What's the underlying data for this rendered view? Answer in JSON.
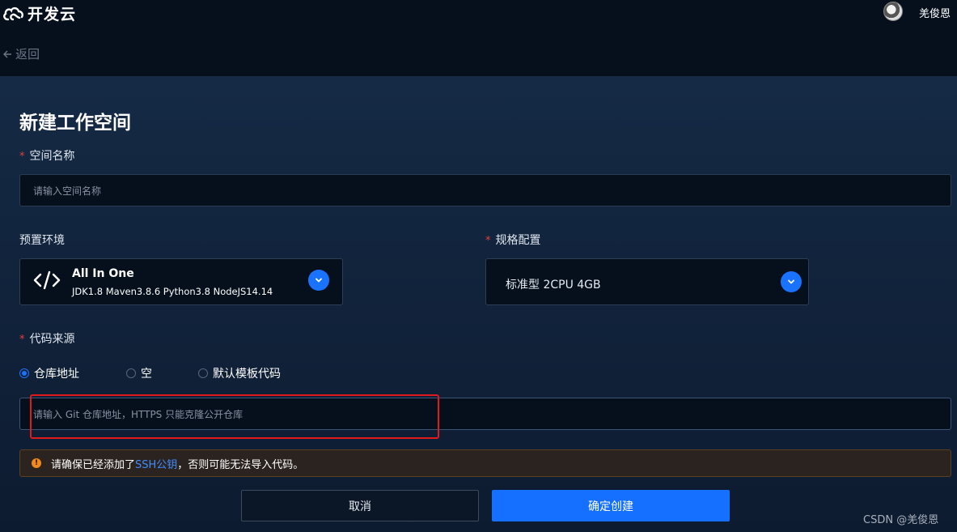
{
  "header": {
    "logo_text": "开发云",
    "username": "羌俊恩"
  },
  "nav": {
    "back_label": "返回"
  },
  "form": {
    "title": "新建工作空间",
    "space_name": {
      "required_mark": "*",
      "label": "空间名称",
      "placeholder": "请输入空间名称"
    },
    "preset_env": {
      "label": "预置环境",
      "selected_title": "All In One",
      "selected_desc": "JDK1.8 Maven3.8.6 Python3.8 NodeJS14.14",
      "icon": "code-icon"
    },
    "spec": {
      "required_mark": "*",
      "label": "规格配置",
      "selected": "标准型 2CPU 4GB"
    },
    "code_source": {
      "required_mark": "*",
      "label": "代码来源",
      "options": [
        {
          "label": "仓库地址",
          "checked": true
        },
        {
          "label": "空",
          "checked": false
        },
        {
          "label": "默认模板代码",
          "checked": false
        }
      ],
      "repo_placeholder": "请输入 Git 仓库地址，HTTPS 只能克隆公开仓库"
    },
    "alert": {
      "prefix": "请确保已经添加了 ",
      "link": "SSH公钥",
      "suffix": "，否则可能无法导入代码。"
    },
    "buttons": {
      "cancel": "取消",
      "confirm": "确定创建"
    }
  },
  "watermark": "CSDN @羌俊恩",
  "colors": {
    "accent": "#1570ff",
    "required": "#e0403d",
    "annotation": "#e0191a",
    "warning": "#f08a1c"
  }
}
